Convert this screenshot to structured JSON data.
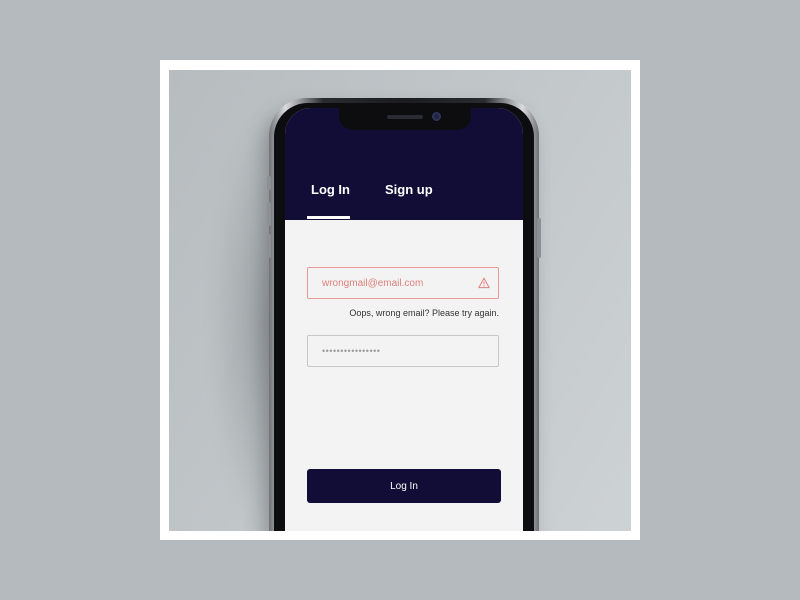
{
  "tabs": {
    "login_label": "Log In",
    "signup_label": "Sign up",
    "active": "Log In"
  },
  "form": {
    "email_value": "wrongmail@email.com",
    "email_error": "Oops, wrong email? Please try again.",
    "password_value": "••••••••••••••••",
    "submit_label": "Log In"
  },
  "icons": {
    "email_status": "warning-triangle-icon"
  },
  "colors": {
    "header_bg": "#120d36",
    "screen_bg": "#f3f3f3",
    "error": "#e0807c",
    "button_bg": "#120d36",
    "button_text": "#ffffff"
  }
}
